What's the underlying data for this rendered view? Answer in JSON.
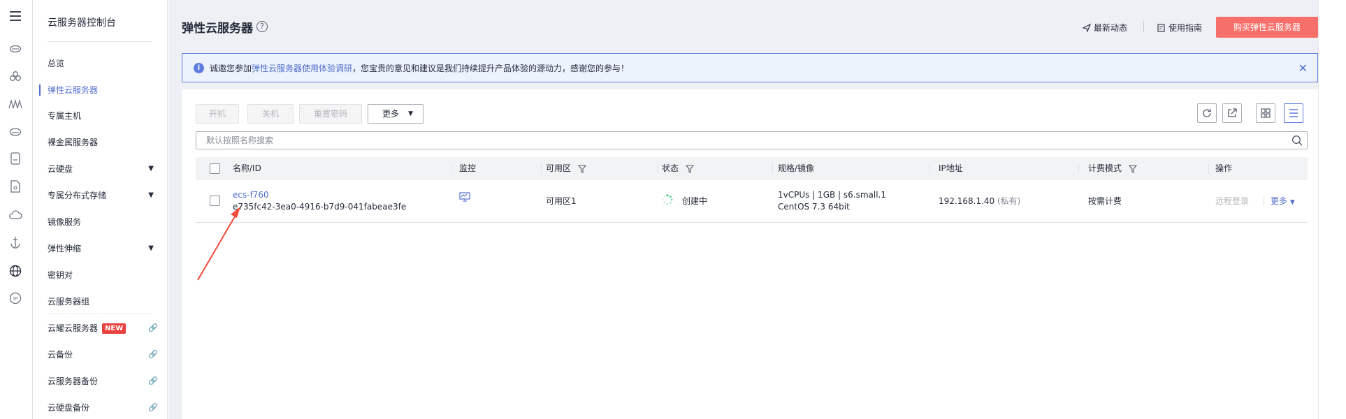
{
  "colors": {
    "primary": "#5e7ce0",
    "link": "#526ecc",
    "buy_button": "#f66f6a",
    "annotation_arrow": "#f24a3c",
    "badge_new": "#e8403f"
  },
  "rail": {
    "icons": [
      "menu-icon",
      "cloud-icon",
      "cluster-icon",
      "waves-icon",
      "cloud-disk-icon",
      "storage-icon",
      "document-icon",
      "cloud-outline-icon",
      "anchor-icon",
      "globe-icon",
      "ip-icon"
    ]
  },
  "sidebar": {
    "title": "云服务器控制台",
    "items": [
      {
        "label": "总览"
      },
      {
        "label": "弹性云服务器",
        "active": true
      },
      {
        "label": "专属主机"
      },
      {
        "label": "裸金属服务器"
      },
      {
        "label": "云硬盘",
        "expandable": true
      },
      {
        "label": "专属分布式存储",
        "expandable": true
      },
      {
        "label": "镜像服务"
      },
      {
        "label": "弹性伸缩",
        "expandable": true
      },
      {
        "label": "密钥对"
      },
      {
        "label": "云服务器组"
      },
      {
        "label": "云耀云服务器",
        "badge": "NEW",
        "external": true
      },
      {
        "label": "云备份",
        "external": true
      },
      {
        "label": "云服务器备份",
        "external": true
      },
      {
        "label": "云硬盘备份",
        "external": true
      }
    ]
  },
  "header": {
    "title": "弹性云服务器",
    "help_icon": "question-circle-icon",
    "links": [
      "最新动态",
      "使用指南"
    ],
    "buy_button": "购买弹性云服务器"
  },
  "notice": {
    "prefix": "诚邀您参加",
    "link": "弹性云服务器使用体验调研",
    "suffix": "，您宝贵的意见和建议是我们持续提升产品体验的源动力，感谢您的参与！",
    "close_icon": "close-icon"
  },
  "toolbar": {
    "buttons": [
      "开机",
      "关机",
      "重置密码"
    ],
    "more": "更多",
    "icons": [
      "refresh-icon",
      "export-icon",
      "grid-view-icon",
      "list-view-icon"
    ]
  },
  "search": {
    "placeholder": "默认按照名称搜索",
    "value": ""
  },
  "table": {
    "columns": [
      "名称/ID",
      "监控",
      "可用区",
      "状态",
      "规格/镜像",
      "IP地址",
      "计费模式",
      "操作"
    ],
    "rows": [
      {
        "name": "ecs-f760",
        "id": "e735fc42-3ea0-4916-b7d9-041fabeae3fe",
        "monitor_icon": "monitor-icon",
        "zone": "可用区1",
        "status": "创建中",
        "spec": "1vCPUs | 1GB | s6.small.1",
        "image": "CentOS 7.3 64bit",
        "ip": "192.168.1.40",
        "ip_type": "(私有)",
        "billing": "按需计费",
        "actions": [
          "远程登录",
          "更多"
        ]
      }
    ]
  }
}
